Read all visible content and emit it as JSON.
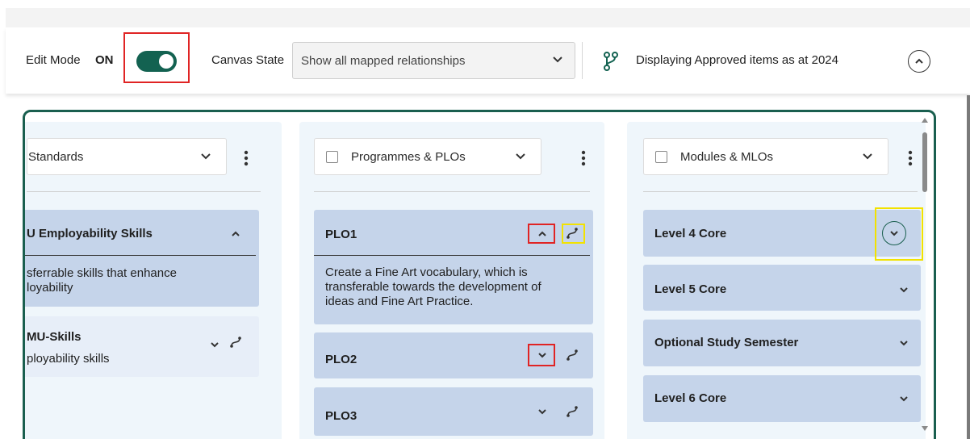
{
  "toolbar": {
    "edit_mode_label": "Edit Mode",
    "edit_mode_state": "ON",
    "edit_mode_on": true,
    "canvas_state_label": "Canvas State",
    "canvas_state_value": "Show all mapped relationships",
    "display_text": "Displaying Approved items as at 2024"
  },
  "columns": [
    {
      "header": "Standards",
      "has_checkbox": false,
      "cards": [
        {
          "title": "U Employability Skills",
          "description": [
            "sferrable skills that enhance",
            "loyability"
          ],
          "expanded": true
        },
        {
          "title": "MU-Skills",
          "description": [
            "ployability skills"
          ],
          "expanded": false
        }
      ]
    },
    {
      "header": "Programmes & PLOs",
      "has_checkbox": true,
      "cards": [
        {
          "title": "PLO1",
          "description": [
            "Create a Fine Art vocabulary, which is",
            "transferable towards the development of",
            "ideas and Fine Art Practice."
          ],
          "expanded": true
        },
        {
          "title": "PLO2",
          "description": [],
          "expanded": false
        },
        {
          "title": "PLO3",
          "description": [],
          "expanded": false
        }
      ]
    },
    {
      "header": "Modules & MLOs",
      "has_checkbox": true,
      "cards": [
        {
          "title": "Level 4 Core",
          "expanded": false
        },
        {
          "title": "Level 5 Core",
          "expanded": false
        },
        {
          "title": "Optional Study Semester",
          "expanded": false
        },
        {
          "title": "Level 6 Core",
          "expanded": false
        }
      ]
    }
  ],
  "colors": {
    "accent": "#136251",
    "card": "#c5d4ea",
    "column_bg": "#eff6fb",
    "highlight_red": "#e02424",
    "highlight_yellow": "#f2e200"
  },
  "icons": [
    "chevron-down-icon",
    "chevron-up-icon",
    "kebab-menu-icon",
    "link-route-icon",
    "branch-icon",
    "scroll-arrow-icon"
  ]
}
